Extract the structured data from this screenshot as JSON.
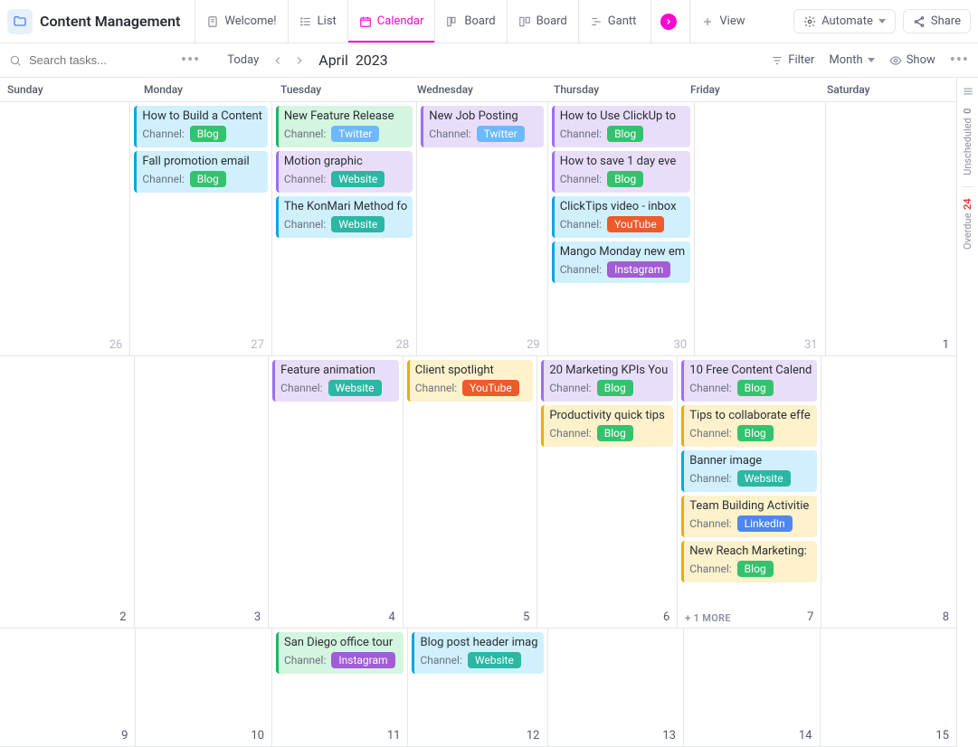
{
  "header": {
    "title": "Content Management",
    "tabs": [
      {
        "label": "Welcome!",
        "icon": "doc"
      },
      {
        "label": "List",
        "icon": "list"
      },
      {
        "label": "Calendar",
        "icon": "calendar",
        "active": true
      },
      {
        "label": "Board",
        "icon": "board-star"
      },
      {
        "label": "Board",
        "icon": "board"
      },
      {
        "label": "Gantt",
        "icon": "gantt"
      }
    ],
    "add_view": "View",
    "automate": "Automate",
    "share": "Share"
  },
  "toolbar": {
    "search_placeholder": "Search tasks...",
    "today": "Today",
    "month": "April",
    "year": "2023",
    "filter": "Filter",
    "scale": "Month",
    "show": "Show"
  },
  "dow": [
    "Sunday",
    "Monday",
    "Tuesday",
    "Wednesday",
    "Thursday",
    "Friday",
    "Saturday"
  ],
  "side": {
    "unscheduled_count": "0",
    "unscheduled_label": "Unscheduled",
    "overdue_count": "24",
    "overdue_label": "Overdue"
  },
  "more_label": "+ 1 MORE",
  "weeks": [
    {
      "height": "h280",
      "days": [
        {
          "date": "26",
          "dim": true,
          "events": []
        },
        {
          "date": "27",
          "dim": true,
          "events": [
            {
              "title": "How to Build a Content",
              "bg": "blue",
              "channel": "Blog",
              "tag": "blog"
            },
            {
              "title": "Fall promotion email",
              "bg": "blue",
              "channel": "Blog",
              "tag": "blog"
            }
          ]
        },
        {
          "date": "28",
          "dim": true,
          "events": [
            {
              "title": "New Feature Release",
              "bg": "green",
              "channel": "Twitter",
              "tag": "twitter"
            },
            {
              "title": "Motion graphic",
              "bg": "purple",
              "channel": "Website",
              "tag": "website"
            },
            {
              "title": "The KonMari Method fo",
              "bg": "blue",
              "channel": "Website",
              "tag": "website"
            }
          ]
        },
        {
          "date": "29",
          "dim": true,
          "events": [
            {
              "title": "New Job Posting",
              "bg": "purple",
              "channel": "Twitter",
              "tag": "twitter"
            }
          ]
        },
        {
          "date": "30",
          "dim": true,
          "events": [
            {
              "title": "How to Use ClickUp to",
              "bg": "purple",
              "channel": "Blog",
              "tag": "blog"
            },
            {
              "title": "How to save 1 day eve",
              "bg": "purple",
              "channel": "Blog",
              "tag": "blog"
            },
            {
              "title": "ClickTips video - inbox",
              "bg": "blue",
              "channel": "YouTube",
              "tag": "youtube"
            },
            {
              "title": "Mango Monday new em",
              "bg": "blue",
              "channel": "Instagram",
              "tag": "instagram"
            }
          ]
        },
        {
          "date": "31",
          "dim": true,
          "events": []
        },
        {
          "date": "1",
          "events": []
        }
      ]
    },
    {
      "height": "h300",
      "days": [
        {
          "date": "2",
          "events": []
        },
        {
          "date": "3",
          "events": []
        },
        {
          "date": "4",
          "events": [
            {
              "title": "Feature animation",
              "bg": "purple",
              "channel": "Website",
              "tag": "website"
            }
          ]
        },
        {
          "date": "5",
          "events": [
            {
              "title": "Client spotlight",
              "bg": "yellow",
              "channel": "YouTube",
              "tag": "youtube"
            }
          ]
        },
        {
          "date": "6",
          "events": [
            {
              "title": "20 Marketing KPIs You",
              "bg": "purple",
              "channel": "Blog",
              "tag": "blog"
            },
            {
              "title": "Productivity quick tips",
              "bg": "yellow",
              "channel": "Blog",
              "tag": "blog"
            }
          ]
        },
        {
          "date": "7",
          "more": true,
          "events": [
            {
              "title": "10 Free Content Calend",
              "bg": "purple",
              "channel": "Blog",
              "tag": "blog"
            },
            {
              "title": "Tips to collaborate effe",
              "bg": "yellow",
              "channel": "Blog",
              "tag": "blog"
            },
            {
              "title": "Banner image",
              "bg": "blue",
              "channel": "Website",
              "tag": "website"
            },
            {
              "title": "Team Building Activitie",
              "bg": "yellow",
              "channel": "LinkedIn",
              "tag": "linkedin"
            },
            {
              "title": "New Reach Marketing:",
              "bg": "yellow",
              "channel": "Blog",
              "tag": "blog"
            }
          ]
        },
        {
          "date": "8",
          "events": []
        }
      ]
    },
    {
      "height": "h140",
      "days": [
        {
          "date": "9",
          "events": []
        },
        {
          "date": "10",
          "events": []
        },
        {
          "date": "11",
          "events": [
            {
              "title": "San Diego office tour",
              "bg": "green",
              "channel": "Instagram",
              "tag": "instagram"
            }
          ]
        },
        {
          "date": "12",
          "events": [
            {
              "title": "Blog post header imag",
              "bg": "blue",
              "channel": "Website",
              "tag": "website"
            }
          ]
        },
        {
          "date": "13",
          "events": []
        },
        {
          "date": "14",
          "events": []
        },
        {
          "date": "15",
          "events": []
        }
      ]
    }
  ],
  "channel_label": "Channel:"
}
